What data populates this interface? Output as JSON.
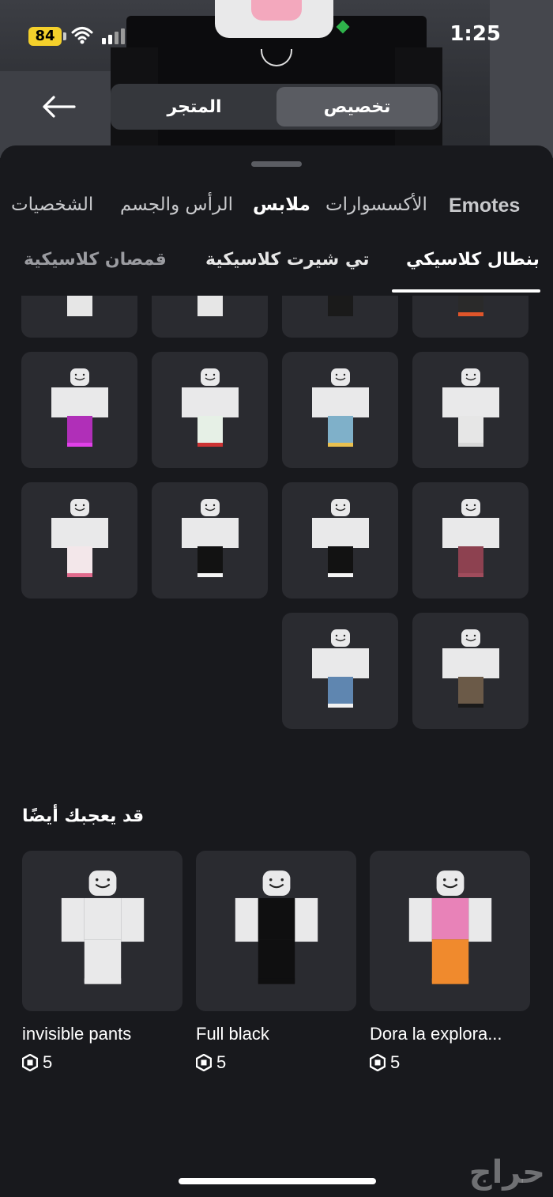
{
  "status_bar": {
    "battery": "84",
    "time": "1:25"
  },
  "header": {
    "segments": {
      "store": "المتجر",
      "customize": "تخصيص"
    }
  },
  "category_tabs": [
    "الشخصيات",
    "الرأس والجسم",
    "ملابس",
    "الأكسسوارات",
    "Emotes"
  ],
  "sub_tabs": [
    "قمصان كلاسيكية",
    "تي شيرت كلاسيكية",
    "بنطال كلاسيكي"
  ],
  "items": [
    {
      "pants": "#2a2a2a",
      "accent": "#e0552a"
    },
    {
      "pants": "#1a1a1a",
      "accent": "#1a1a1a"
    },
    {
      "pants": "#e6e6e6",
      "accent": "#e6e6e6"
    },
    {
      "pants": "#e6e6e6",
      "accent": "#e6e6e6"
    },
    {
      "pants": "#e6e6e6",
      "accent": "#d7d7d7"
    },
    {
      "pants": "#7fb0c9",
      "accent": "#e9c04f"
    },
    {
      "pants": "#e6f0e6",
      "accent": "#cc3333"
    },
    {
      "pants": "#b02fb8",
      "accent": "#e040e8"
    },
    {
      "pants": "#8d4150",
      "accent": "#a04c5c"
    },
    {
      "pants": "#121212",
      "accent": "#f5f5f5"
    },
    {
      "pants": "#121212",
      "accent": "#f5f5f5"
    },
    {
      "pants": "#f3e7ea",
      "accent": "#e06a8c"
    },
    {
      "pants": "#6b5a48",
      "accent": "#1a1a1a"
    },
    {
      "pants": "#5f86b0",
      "accent": "#f2f2f2"
    }
  ],
  "recommended": {
    "title": "قد يعجبك أيضًا",
    "items": [
      {
        "name": "invisible pants",
        "price": "5",
        "torso": "#e9e9ea",
        "legs": "#e9e9ea"
      },
      {
        "name": "Full black",
        "price": "5",
        "torso": "#0f0f10",
        "legs": "#0f0f10"
      },
      {
        "name": "Dora la explora...",
        "price": "5",
        "torso": "#e882b8",
        "legs": "#f08a2d"
      }
    ]
  },
  "watermark": "حراج"
}
